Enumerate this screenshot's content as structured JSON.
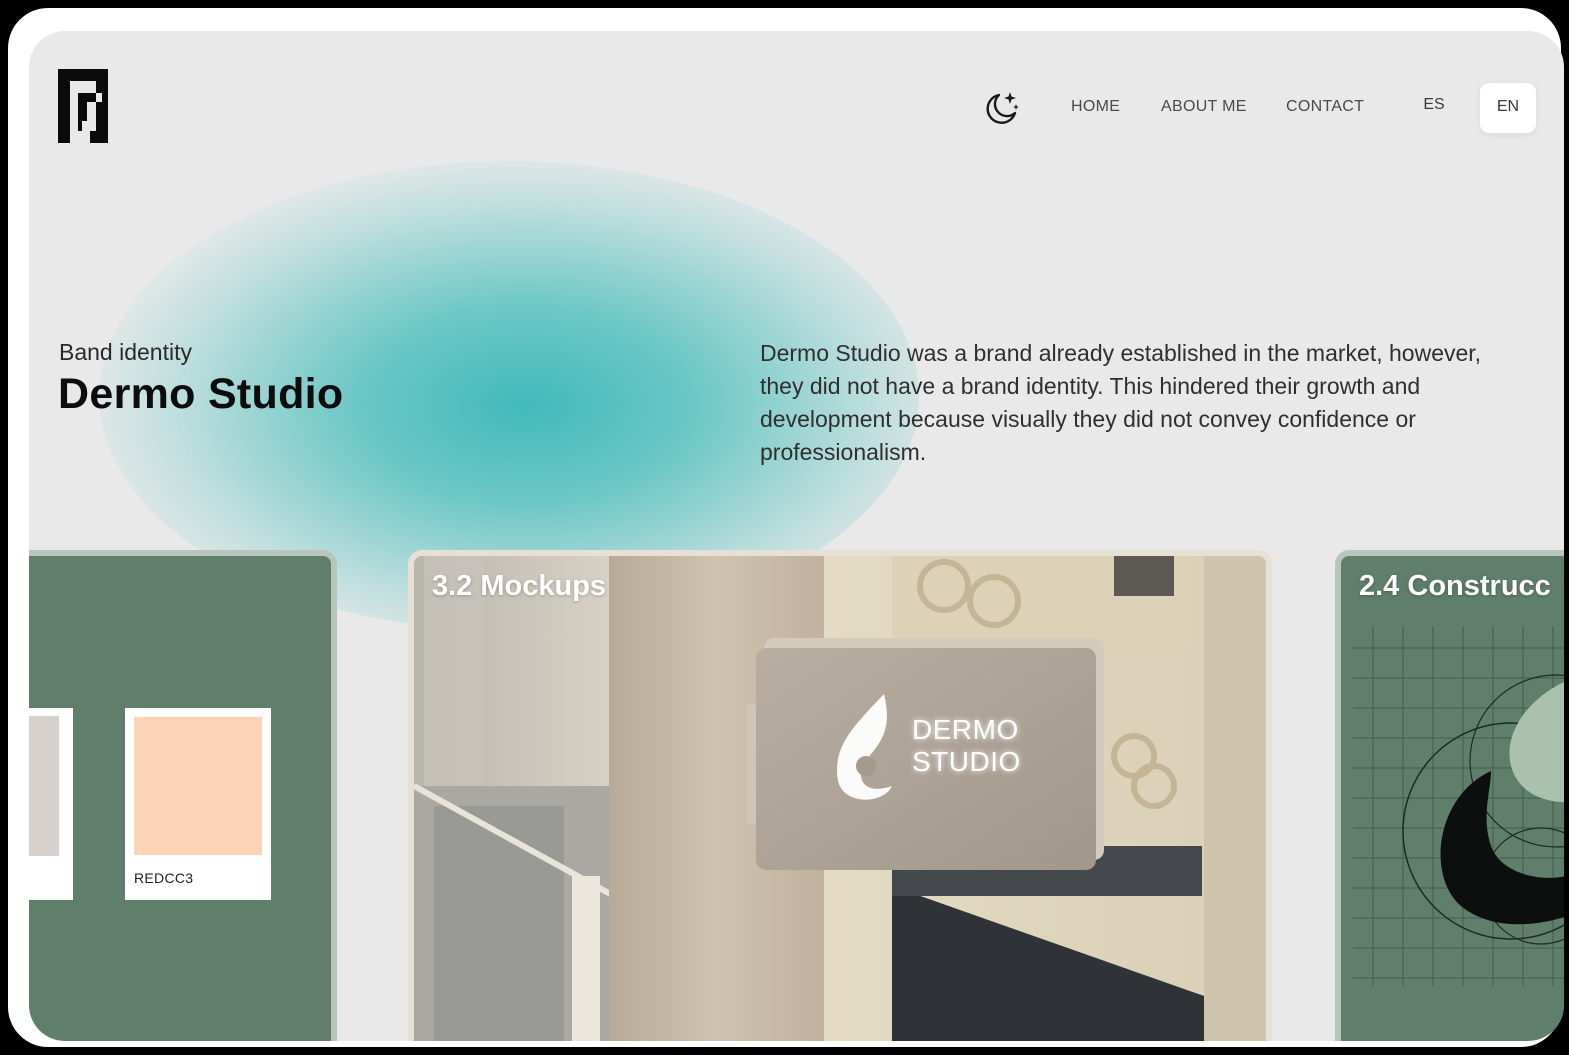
{
  "header": {
    "nav": [
      {
        "label": "HOME"
      },
      {
        "label": "ABOUT ME"
      },
      {
        "label": "CONTACT"
      }
    ],
    "languages": [
      {
        "label": "ES",
        "active": false
      },
      {
        "label": "EN",
        "active": true
      }
    ],
    "icons": {
      "logo": "monogram-logo",
      "theme": "moon-stars-icon"
    }
  },
  "hero": {
    "subtitle": "Band identity",
    "title": "Dermo Studio",
    "description": "Dermo Studio was a brand already established in the market, however, they did not have a brand identity. This hindered their growth and development because visually they did not convey confidence or professionalism."
  },
  "gallery": {
    "palette_card": {
      "swatch_code": "REDCC3"
    },
    "mockup_card": {
      "label": "3.2 Mockups",
      "sign_line1": "DERMO",
      "sign_line2": "STUDIO"
    },
    "construction_card": {
      "label": "2.4 Construcc"
    }
  },
  "colors": {
    "background": "#e9e9ea",
    "accent_teal": "#4ec1bf",
    "card_green": "#5f7e6b",
    "swatch_peach": "#fcd3b7",
    "swatch_gray": "#d6d1cd"
  }
}
